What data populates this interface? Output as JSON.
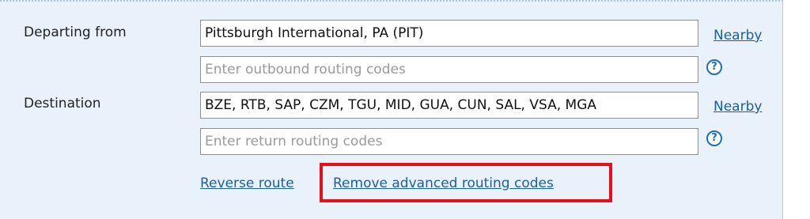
{
  "form": {
    "departing_label": "Departing from",
    "departing_value": "Pittsburgh International, PA (PIT)",
    "outbound_placeholder": "Enter outbound routing codes",
    "destination_label": "Destination",
    "destination_value": "BZE, RTB, SAP, CZM, TGU, MID, GUA, CUN, SAL, VSA, MGA",
    "return_placeholder": "Enter return routing codes",
    "nearby_label": "Nearby",
    "help_glyph": "?",
    "reverse_route_label": "Reverse route",
    "remove_advanced_label": "Remove advanced routing codes"
  },
  "colors": {
    "panel_background": "#e9f2fa",
    "link": "#1a5ea8",
    "highlight_border": "#e5111a"
  },
  "icons": {
    "help": "help-circle-icon"
  }
}
